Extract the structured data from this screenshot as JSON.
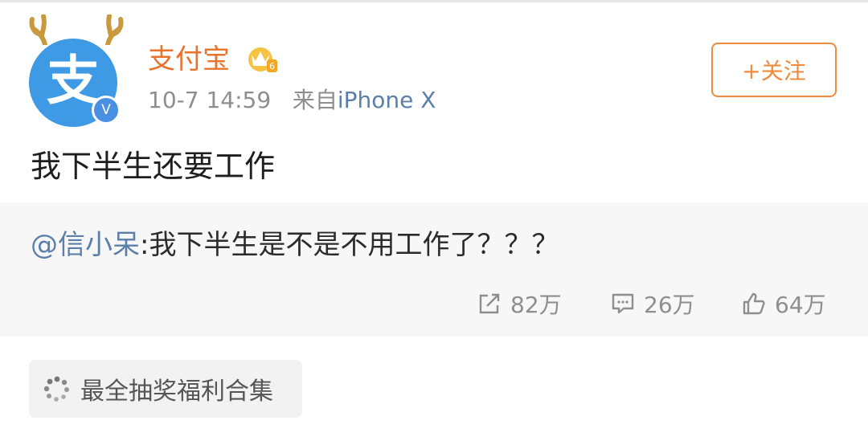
{
  "post": {
    "user_name": "支付宝",
    "time": "10-7 14:59",
    "source_prefix": "来自",
    "source_device": "iPhone X",
    "follow_label": "+关注",
    "text": "我下半生还要工作",
    "avatar_glyph": "支",
    "verified_badge": "V"
  },
  "repost": {
    "mention": "@信小呆",
    "text": ":我下半生是不是不用工作了？？？"
  },
  "stats": {
    "reposts": "82万",
    "comments": "26万",
    "likes": "64万"
  },
  "topic": {
    "label": "最全抽奖福利合集"
  },
  "colors": {
    "name": "#e8732c",
    "link": "#5b7fa8",
    "follow": "#f08a3c",
    "avatar_bg": "#3f9ae5"
  },
  "icons": {
    "repost": "share-out-icon",
    "comment": "comment-bubble-icon",
    "like": "thumbs-up-icon",
    "topic": "loading-dots-icon",
    "vip": "crown-badge-icon",
    "antlers": "deer-antler-icon"
  }
}
